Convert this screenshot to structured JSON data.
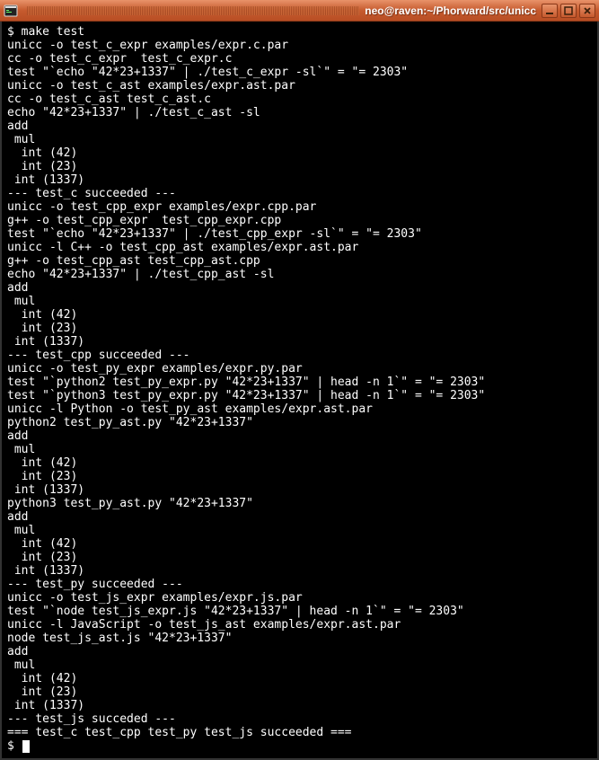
{
  "titlebar": {
    "title": "neo@raven:~/Phorward/src/unicc"
  },
  "terminal": {
    "prompt": "$ ",
    "command": "make test",
    "lines": [
      "unicc -o test_c_expr examples/expr.c.par",
      "cc -o test_c_expr  test_c_expr.c",
      "test \"`echo \"42*23+1337\" | ./test_c_expr -sl`\" = \"= 2303\"",
      "unicc -o test_c_ast examples/expr.ast.par",
      "cc -o test_c_ast test_c_ast.c",
      "echo \"42*23+1337\" | ./test_c_ast -sl",
      "add",
      " mul",
      "  int (42)",
      "  int (23)",
      " int (1337)",
      "--- test_c succeeded ---",
      "unicc -o test_cpp_expr examples/expr.cpp.par",
      "g++ -o test_cpp_expr  test_cpp_expr.cpp",
      "test \"`echo \"42*23+1337\" | ./test_cpp_expr -sl`\" = \"= 2303\"",
      "unicc -l C++ -o test_cpp_ast examples/expr.ast.par",
      "g++ -o test_cpp_ast test_cpp_ast.cpp",
      "echo \"42*23+1337\" | ./test_cpp_ast -sl",
      "add",
      " mul",
      "  int (42)",
      "  int (23)",
      " int (1337)",
      "--- test_cpp succeeded ---",
      "unicc -o test_py_expr examples/expr.py.par",
      "test \"`python2 test_py_expr.py \"42*23+1337\" | head -n 1`\" = \"= 2303\"",
      "test \"`python3 test_py_expr.py \"42*23+1337\" | head -n 1`\" = \"= 2303\"",
      "unicc -l Python -o test_py_ast examples/expr.ast.par",
      "python2 test_py_ast.py \"42*23+1337\"",
      "add",
      " mul",
      "  int (42)",
      "  int (23)",
      " int (1337)",
      "python3 test_py_ast.py \"42*23+1337\"",
      "add",
      " mul",
      "  int (42)",
      "  int (23)",
      " int (1337)",
      "--- test_py succeeded ---",
      "unicc -o test_js_expr examples/expr.js.par",
      "test \"`node test_js_expr.js \"42*23+1337\" | head -n 1`\" = \"= 2303\"",
      "unicc -l JavaScript -o test_js_ast examples/expr.ast.par",
      "node test_js_ast.js \"42*23+1337\"",
      "add",
      " mul",
      "  int (42)",
      "  int (23)",
      " int (1337)",
      "--- test_js succeded ---",
      "=== test_c test_cpp test_py test_js succeeded ==="
    ],
    "final_prompt": "$ "
  }
}
